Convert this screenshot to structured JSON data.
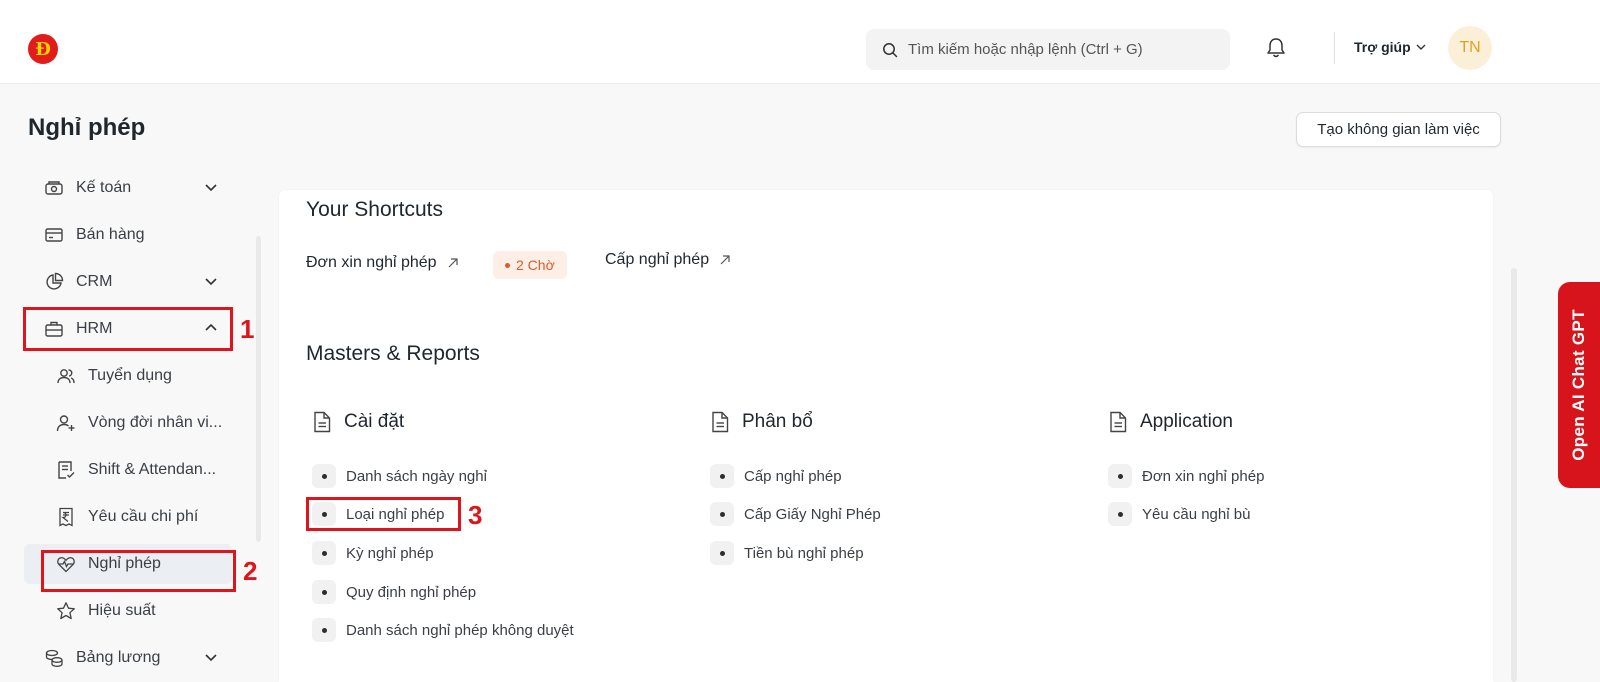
{
  "navbar": {
    "logo_letter": "Đ",
    "search_placeholder": "Tìm kiếm hoặc nhập lệnh (Ctrl + G)",
    "help_label": "Trợ giúp",
    "avatar_initials": "TN"
  },
  "page": {
    "title": "Nghỉ phép",
    "create_workspace_label": "Tạo không gian làm việc"
  },
  "sidebar": {
    "items": [
      {
        "label": "Kế toán",
        "icon": "piggy-bank-icon",
        "expandable": true
      },
      {
        "label": "Bán hàng",
        "icon": "card-icon",
        "expandable": false
      },
      {
        "label": "CRM",
        "icon": "pie-chart-icon",
        "expandable": true
      },
      {
        "label": "HRM",
        "icon": "briefcase-icon",
        "expandable": true,
        "expanded": true
      },
      {
        "label": "Tuyển dụng",
        "icon": "users-icon",
        "child": true
      },
      {
        "label": "Vòng đời nhân vi...",
        "icon": "user-add-icon",
        "child": true
      },
      {
        "label": "Shift & Attendan...",
        "icon": "checklist-icon",
        "child": true
      },
      {
        "label": "Yêu cầu chi phí",
        "icon": "rupee-receipt-icon",
        "child": true
      },
      {
        "label": "Nghỉ phép",
        "icon": "heartbeat-icon",
        "child": true,
        "active": true
      },
      {
        "label": "Hiệu suất",
        "icon": "star-icon",
        "child": true
      },
      {
        "label": "Bảng lương",
        "icon": "coins-icon",
        "expandable": true
      }
    ]
  },
  "annotations": {
    "hrm_number": "1",
    "leave_number": "2",
    "leave_type_number": "3"
  },
  "shortcuts": {
    "heading": "Your Shortcuts",
    "items": [
      {
        "label": "Đơn xin nghỉ phép",
        "badge": "2 Chờ"
      },
      {
        "label": "Cấp nghỉ phép"
      }
    ]
  },
  "reports": {
    "heading": "Masters & Reports",
    "groups": [
      {
        "title": "Cài đặt",
        "links": [
          "Danh sách ngày nghỉ",
          "Loại nghỉ phép",
          "Kỳ nghỉ phép",
          "Quy định nghỉ phép",
          "Danh sách nghỉ phép không duyệt"
        ]
      },
      {
        "title": "Phân bổ",
        "links": [
          "Cấp nghỉ phép",
          "Cấp Giấy Nghỉ Phép",
          "Tiền bù nghỉ phép"
        ]
      },
      {
        "title": "Application",
        "links": [
          "Đơn xin nghỉ phép",
          "Yêu cầu nghỉ bù"
        ]
      }
    ]
  },
  "ai_tab": {
    "label": "Open AI Chat GPT"
  },
  "colors": {
    "highlight": "#e0151c",
    "badge_text": "#e05a2b",
    "ai_tab": "#d7131c"
  }
}
